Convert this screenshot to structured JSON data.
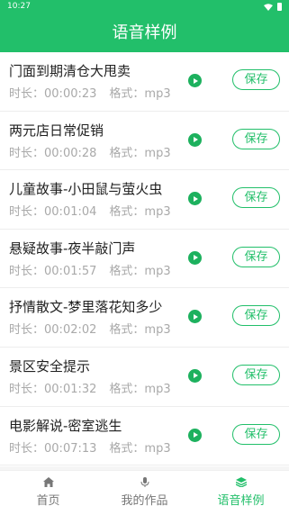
{
  "status_bar": {
    "time": "10:27"
  },
  "header": {
    "title": "语音样例"
  },
  "items": [
    {
      "title": "门面到期清仓大甩卖",
      "duration_label": "时长：",
      "duration": "00:00:23",
      "format_label": "格式：",
      "format": "mp3",
      "save_label": "保存"
    },
    {
      "title": "两元店日常促销",
      "duration_label": "时长：",
      "duration": "00:00:28",
      "format_label": "格式：",
      "format": "mp3",
      "save_label": "保存"
    },
    {
      "title": "儿童故事-小田鼠与萤火虫",
      "duration_label": "时长：",
      "duration": "00:01:04",
      "format_label": "格式：",
      "format": "mp3",
      "save_label": "保存"
    },
    {
      "title": "悬疑故事-夜半敲门声",
      "duration_label": "时长：",
      "duration": "00:01:57",
      "format_label": "格式：",
      "format": "mp3",
      "save_label": "保存"
    },
    {
      "title": "抒情散文-梦里落花知多少",
      "duration_label": "时长：",
      "duration": "00:02:02",
      "format_label": "格式：",
      "format": "mp3",
      "save_label": "保存"
    },
    {
      "title": "景区安全提示",
      "duration_label": "时长：",
      "duration": "00:01:32",
      "format_label": "格式：",
      "format": "mp3",
      "save_label": "保存"
    },
    {
      "title": "电影解说-密室逃生",
      "duration_label": "时长：",
      "duration": "00:07:13",
      "format_label": "格式：",
      "format": "mp3",
      "save_label": "保存"
    }
  ],
  "tabs": [
    {
      "label": "首页",
      "icon": "home-icon",
      "active": false
    },
    {
      "label": "我的作品",
      "icon": "microphone-icon",
      "active": false
    },
    {
      "label": "语音样例",
      "icon": "layers-icon",
      "active": true
    }
  ],
  "colors": {
    "accent": "#22bf6a",
    "play": "#1db15e",
    "meta_text": "#a9a9a9"
  }
}
